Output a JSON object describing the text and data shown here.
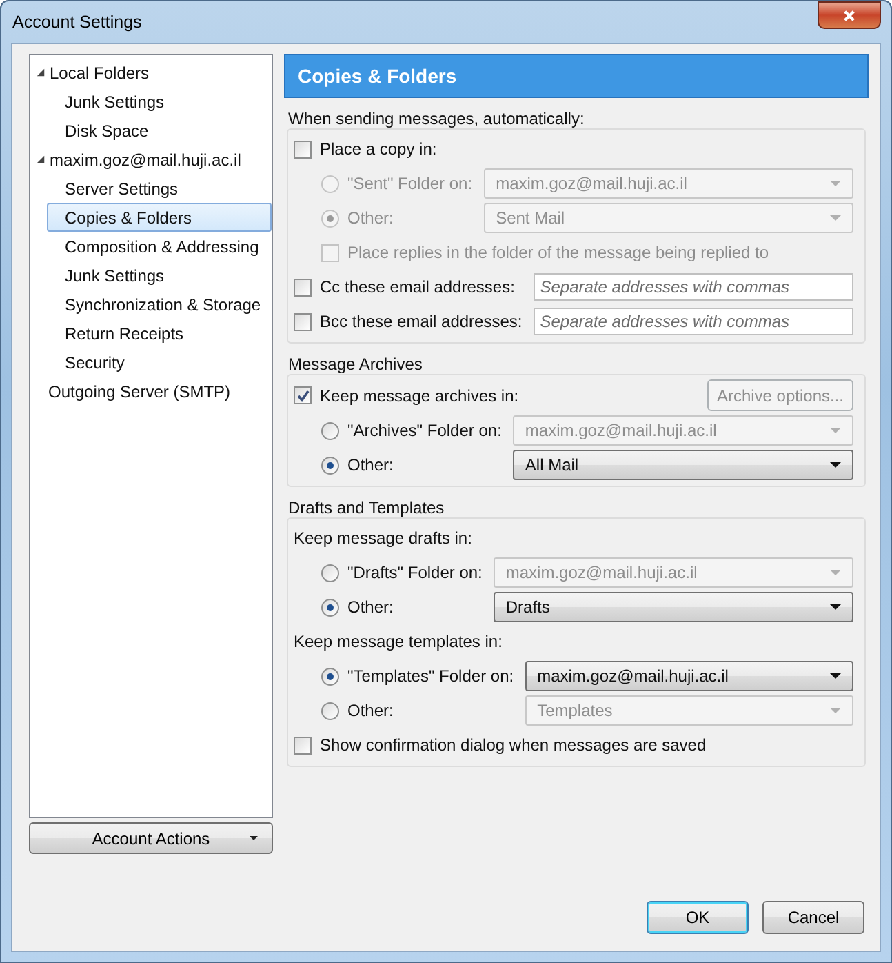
{
  "window": {
    "title": "Account Settings"
  },
  "sidebar": {
    "items": [
      {
        "label": "Local Folders",
        "selected": false,
        "expanded": true,
        "children": [
          {
            "label": "Junk Settings",
            "selected": false
          },
          {
            "label": "Disk Space",
            "selected": false
          }
        ]
      },
      {
        "label": "maxim.goz@mail.huji.ac.il",
        "selected": false,
        "expanded": true,
        "children": [
          {
            "label": "Server Settings",
            "selected": false
          },
          {
            "label": "Copies & Folders",
            "selected": true
          },
          {
            "label": "Composition & Addressing",
            "selected": false
          },
          {
            "label": "Junk Settings",
            "selected": false
          },
          {
            "label": "Synchronization & Storage",
            "selected": false
          },
          {
            "label": "Return Receipts",
            "selected": false
          },
          {
            "label": "Security",
            "selected": false
          }
        ]
      },
      {
        "label": "Outgoing Server (SMTP)",
        "selected": false
      }
    ],
    "account_actions": "Account Actions"
  },
  "panel": {
    "title": "Copies & Folders",
    "sections": [
      {
        "title": "When sending messages, automatically:",
        "rows": [
          {
            "kind": "checkbox",
            "label": "Place a copy in:",
            "checked": false,
            "disabled": false,
            "children": [
              {
                "kind": "radio",
                "label": "\"Sent\" Folder on:",
                "selected": false,
                "disabled": true,
                "dropdown": {
                  "value": "maxim.goz@mail.huji.ac.il",
                  "disabled": true
                }
              },
              {
                "kind": "radio",
                "label": "Other:",
                "selected": true,
                "disabled": true,
                "dropdown": {
                  "value": "Sent Mail",
                  "disabled": true
                }
              },
              {
                "kind": "checkbox",
                "label": "Place replies in the folder of the message being replied to",
                "checked": false,
                "disabled": true
              }
            ]
          },
          {
            "kind": "checkbox",
            "label": "Cc these email addresses:",
            "checked": false,
            "disabled": false,
            "field": {
              "placeholder": "Separate addresses with commas"
            }
          },
          {
            "kind": "checkbox",
            "label": "Bcc these email addresses:",
            "checked": false,
            "disabled": false,
            "field": {
              "placeholder": "Separate addresses with commas"
            }
          }
        ]
      },
      {
        "title": "Message Archives",
        "rows": [
          {
            "kind": "checkbox",
            "label": "Keep message archives in:",
            "checked": true,
            "disabled": false,
            "button": {
              "label": "Archive options...",
              "disabled": true
            },
            "children": [
              {
                "kind": "radio",
                "label": "\"Archives\" Folder on:",
                "selected": false,
                "disabled": false,
                "dropdown": {
                  "value": "maxim.goz@mail.huji.ac.il",
                  "disabled": true
                }
              },
              {
                "kind": "radio",
                "label": "Other:",
                "selected": true,
                "disabled": false,
                "dropdown": {
                  "value": "All Mail",
                  "disabled": false
                }
              }
            ]
          }
        ]
      },
      {
        "title": "Drafts and Templates",
        "rows": [
          {
            "kind": "label",
            "label": "Keep message drafts in:",
            "children": [
              {
                "kind": "radio",
                "label": "\"Drafts\" Folder on:",
                "selected": false,
                "disabled": false,
                "dropdown": {
                  "value": "maxim.goz@mail.huji.ac.il",
                  "disabled": true
                }
              },
              {
                "kind": "radio",
                "label": "Other:",
                "selected": true,
                "disabled": false,
                "dropdown": {
                  "value": "Drafts",
                  "disabled": false
                }
              }
            ]
          },
          {
            "kind": "label",
            "label": "Keep message templates in:",
            "children": [
              {
                "kind": "radio",
                "label": "\"Templates\" Folder on:",
                "selected": true,
                "disabled": false,
                "dropdown": {
                  "value": "maxim.goz@mail.huji.ac.il",
                  "disabled": false
                }
              },
              {
                "kind": "radio",
                "label": "Other:",
                "selected": false,
                "disabled": false,
                "dropdown": {
                  "value": "Templates",
                  "disabled": true
                }
              }
            ]
          },
          {
            "kind": "checkbox",
            "label": "Show confirmation dialog when messages are saved",
            "checked": false,
            "disabled": false
          }
        ]
      }
    ]
  },
  "buttons": [
    {
      "label": "OK",
      "default": true
    },
    {
      "label": "Cancel",
      "default": false
    }
  ]
}
